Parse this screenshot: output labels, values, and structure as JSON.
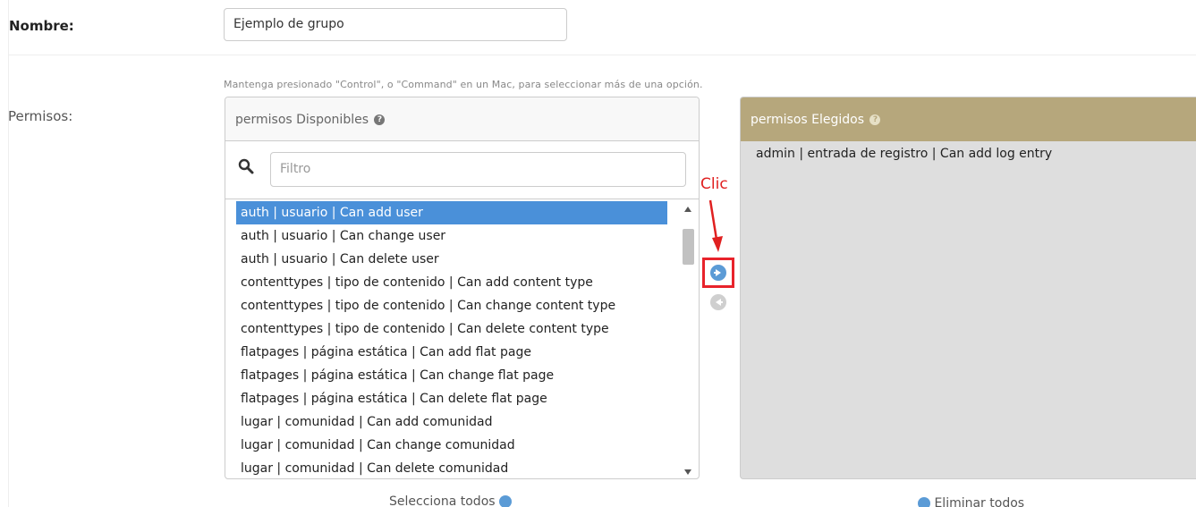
{
  "name_field": {
    "label": "Nombre:",
    "value": "Ejemplo de grupo"
  },
  "permissions": {
    "label": "Permisos:",
    "help_text": "Mantenga presionado \"Control\", o \"Command\" en un Mac, para seleccionar más de una opción.",
    "available": {
      "title": "permisos Disponibles",
      "filter_placeholder": "Filtro",
      "options": [
        "auth | usuario | Can add user",
        "auth | usuario | Can change user",
        "auth | usuario | Can delete user",
        "contenttypes | tipo de contenido | Can add content type",
        "contenttypes | tipo de contenido | Can change content type",
        "contenttypes | tipo de contenido | Can delete content type",
        "flatpages | página estática | Can add flat page",
        "flatpages | página estática | Can change flat page",
        "flatpages | página estática | Can delete flat page",
        "lugar | comunidad | Can add comunidad",
        "lugar | comunidad | Can change comunidad",
        "lugar | comunidad | Can delete comunidad"
      ],
      "selected_index": 0,
      "select_all_label": "Selecciona todos"
    },
    "chosen": {
      "title": "permisos Elegidos",
      "options": [
        "admin | entrada de registro | Can add log entry"
      ],
      "remove_all_label": "Eliminar todos"
    },
    "annotation": "Clic"
  },
  "colors": {
    "selected": "#4a90d9",
    "chosen_header": "#b6a77c",
    "annotation": "#e02020"
  }
}
